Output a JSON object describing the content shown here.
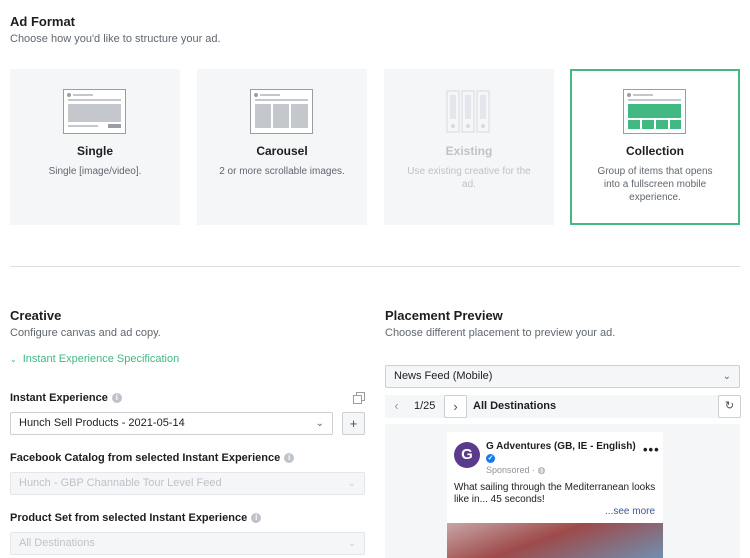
{
  "ad_format": {
    "title": "Ad Format",
    "subtitle": "Choose how you'd like to structure your ad.",
    "cards": [
      {
        "title": "Single",
        "desc": "Single [image/video].",
        "state": "normal"
      },
      {
        "title": "Carousel",
        "desc": "2 or more scrollable images.",
        "state": "normal"
      },
      {
        "title": "Existing",
        "desc": "Use existing creative for the ad.",
        "state": "disabled"
      },
      {
        "title": "Collection",
        "desc": "Group of items that opens into a fullscreen mobile experience.",
        "state": "selected"
      }
    ]
  },
  "creative": {
    "title": "Creative",
    "subtitle": "Configure canvas and ad copy.",
    "spec_link": "Instant Experience Specification",
    "instant_experience_label": "Instant Experience",
    "instant_experience_value": "Hunch Sell Products - 2021-05-14",
    "catalog_label": "Facebook Catalog from selected Instant Experience",
    "catalog_value": "Hunch - GBP Channable Tour Level Feed",
    "product_set_label": "Product Set from selected Instant Experience",
    "product_set_value": "All Destinations"
  },
  "placement": {
    "title": "Placement Preview",
    "subtitle": "Choose different placement to preview your ad.",
    "placement_value": "News Feed (Mobile)",
    "pager": "1/25",
    "destination": "All Destinations"
  },
  "post": {
    "page_name": "G Adventures (GB, IE - English)",
    "sponsored": "Sponsored",
    "text": "What sailing through the Mediterranean looks like in... 45 seconds!",
    "see_more": "...see more",
    "avatar_letter": "G"
  },
  "colors": {
    "accent": "#42b883",
    "text": "#1c1e21",
    "muted": "#606770",
    "card_bg": "#f5f6f7",
    "verified": "#1877f2"
  }
}
